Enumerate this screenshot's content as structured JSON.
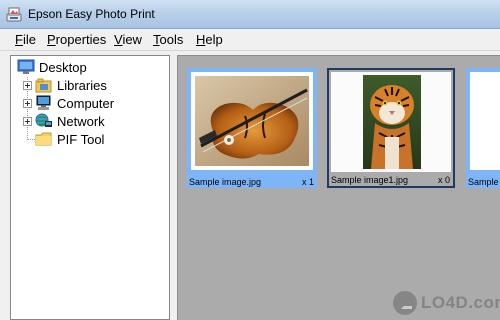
{
  "window": {
    "title": "Epson Easy Photo Print"
  },
  "menu": {
    "file": {
      "first": "F",
      "rest": "ile"
    },
    "properties": {
      "first": "P",
      "rest": "roperties"
    },
    "view": {
      "first": "V",
      "rest": "iew"
    },
    "tools": {
      "first": "T",
      "rest": "ools"
    },
    "help": {
      "first": "H",
      "rest": "elp"
    }
  },
  "tree": {
    "root": {
      "label": "Desktop",
      "icon": "desktop-icon"
    },
    "items": [
      {
        "label": "Libraries",
        "icon": "libraries-icon",
        "expandable": true
      },
      {
        "label": "Computer",
        "icon": "computer-icon",
        "expandable": true
      },
      {
        "label": "Network",
        "icon": "network-icon",
        "expandable": true
      },
      {
        "label": "PIF Tool",
        "icon": "folder-icon",
        "expandable": false
      }
    ]
  },
  "thumbnails": [
    {
      "filename": "Sample image.jpg",
      "count": "x 1",
      "selected": true,
      "subject": "violin"
    },
    {
      "filename": "Sample image1.jpg",
      "count": "x 0",
      "selected": false,
      "subject": "tiger"
    },
    {
      "filename": "Sample",
      "count": "",
      "selected": true,
      "subject": "partial"
    }
  ],
  "watermark": {
    "text": "LO4D.com"
  },
  "colors": {
    "selection": "#7eb5f8",
    "pane_background": "#ababab",
    "titlebar": "#b9d0ea"
  }
}
